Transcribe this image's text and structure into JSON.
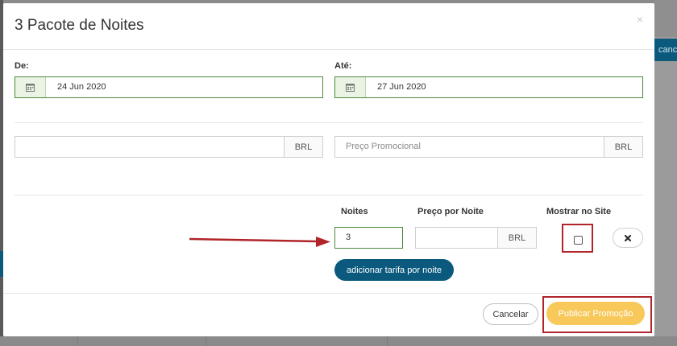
{
  "background": {
    "right_button_label": "canc"
  },
  "modal": {
    "title": "3 Pacote de Noites",
    "close_glyph": "×"
  },
  "dates": {
    "from_label": "De:",
    "from_value": "24 Jun 2020",
    "to_label": "Até:",
    "to_value": "27 Jun 2020",
    "icon": "calendar-icon"
  },
  "prices": {
    "base_currency": "BRL",
    "base_value": "",
    "promo_placeholder": "Preço Promocional",
    "promo_currency": "BRL"
  },
  "table": {
    "col_nights": "Noites",
    "col_price_per_night": "Preço por Noite",
    "col_show_on_site": "Mostrar no Site",
    "row": {
      "nights_value": "3",
      "price_value": "",
      "price_currency": "BRL",
      "show_on_site": false
    }
  },
  "buttons": {
    "add_rate": "adicionar tarifa por noite",
    "remove_icon": "times-icon",
    "cancel": "Cancelar",
    "publish": "Publicar Promoção"
  },
  "colors": {
    "accent_green": "#4a8a3a",
    "primary_blue": "#0b5a7e",
    "publish_yellow": "#f8c95a",
    "annotation_red": "#b0242a"
  }
}
